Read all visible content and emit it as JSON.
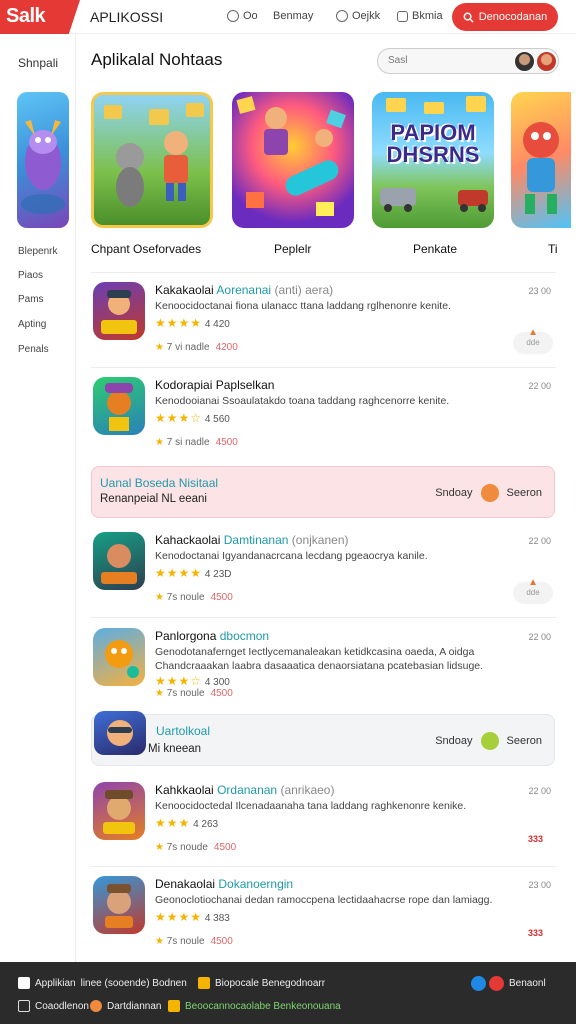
{
  "header": {
    "logo": "Salk",
    "app_title": "APLIKOSSI",
    "nav": [
      {
        "label": "Oo",
        "icon": "circle-icon"
      },
      {
        "label": "Benmay",
        "icon": "none"
      },
      {
        "label": "Oejkk",
        "icon": "circle-icon"
      },
      {
        "label": "Bkmia",
        "icon": "square-icon"
      }
    ],
    "cta_label": "Denocodanan",
    "cta_icon": "search-icon",
    "accent": "#e53935"
  },
  "sidebar": {
    "title": "Shnpali",
    "items": [
      "Blepenrk",
      "Piaos",
      "Pams",
      "Apting",
      "Penals"
    ]
  },
  "main": {
    "title": "Aplikalal Nohtaas",
    "search_placeholder": "Sasl"
  },
  "featured": [
    {
      "label": "Chpant Oseforvades"
    },
    {
      "label": "Peplelr"
    },
    {
      "label": "Penkate",
      "logo_text": "PAPIOM DHSRNS"
    },
    {
      "label": "Ti"
    }
  ],
  "apps": [
    {
      "name": "Kakakaolai",
      "tag": "Aorenanai",
      "extra": "(anti) aera)",
      "desc": "Kenoocidoctanai fiona ulanacc ttana laddang rglhenonre kenite.",
      "stars": "★★★★",
      "rating": "4 420",
      "meta_label": "7 vi nadle",
      "price": "4200",
      "time": "23 00",
      "pill": "dde"
    },
    {
      "name": "Kodorapiai",
      "tag": "Paplselkan",
      "extra": "",
      "desc": "Kenodooianai Ssoaulatakdo toana taddang raghcenorre kenite.",
      "stars": "★★★☆",
      "rating": "4 560",
      "meta_label": "7 si nadle",
      "price": "4500",
      "time": "22 00",
      "pill": ""
    },
    {
      "name": "Kahackaolai",
      "tag": "Damtinanan",
      "extra": "(onjkanen)",
      "desc": "Kenodoctanai Igyandanacrcana lecdang pgeaocrya kanile.",
      "stars": "★★★★",
      "rating": "4 23D",
      "meta_label": "7s noule",
      "price": "4500",
      "time": "22 00",
      "pill": "dde"
    },
    {
      "name": "Panlorgona",
      "tag": "dbocmon",
      "extra": "",
      "desc": "Genodotanafernget Iectlycemanaleakan ketidkcasina oaeda, A oidga",
      "desc2": "Chandcraaakan laabra dasaaatica denaorsiatana pcatebasian lidsuge.",
      "stars": "★★★☆",
      "rating": "4 300",
      "meta_label": "7s noule",
      "price": "4500",
      "time": "22 00",
      "pill": ""
    },
    {
      "name": "Kahkkaolai",
      "tag": "Ordananan",
      "extra": "(anrikaeo)",
      "desc": "Kenoocidoctedal Ilcenadaanaha tana laddang raghkenonre kenike.",
      "stars": "★★★",
      "rating": "4 263",
      "meta_label": "7s noude",
      "price": "4500",
      "time": "22 00",
      "badge": "333"
    },
    {
      "name": "Denakaolai",
      "tag": "Dokanoerngin",
      "extra": "",
      "desc": "Geonoclotiochanai dedan ramoccpena lectidaahacrse rope dan lamiagg.",
      "stars": "★★★★",
      "rating": "4 383",
      "meta_label": "7s noule",
      "price": "4500",
      "time": "23 00",
      "badge": "333"
    }
  ],
  "banners": [
    {
      "title": "Uanal Boseda Nisitaal",
      "sub": "Renanpeial NL eeani",
      "right_a": "Sndoay",
      "right_b": "Seeron"
    },
    {
      "title": "Uartolkoal",
      "sub": "Mi kneean",
      "right_a": "Sndoay",
      "right_b": "Seeron"
    }
  ],
  "footer": {
    "line1a": "Applikian",
    "line1b": "linee (sooende) Bodnen",
    "line1c": "Biopocale Benegodnoarr",
    "line2a": "Coaodlenon",
    "line2b": "Dartdiannan",
    "line2c": "Beoocannocaolabe Benkeonouana",
    "social": "Benaonl"
  }
}
